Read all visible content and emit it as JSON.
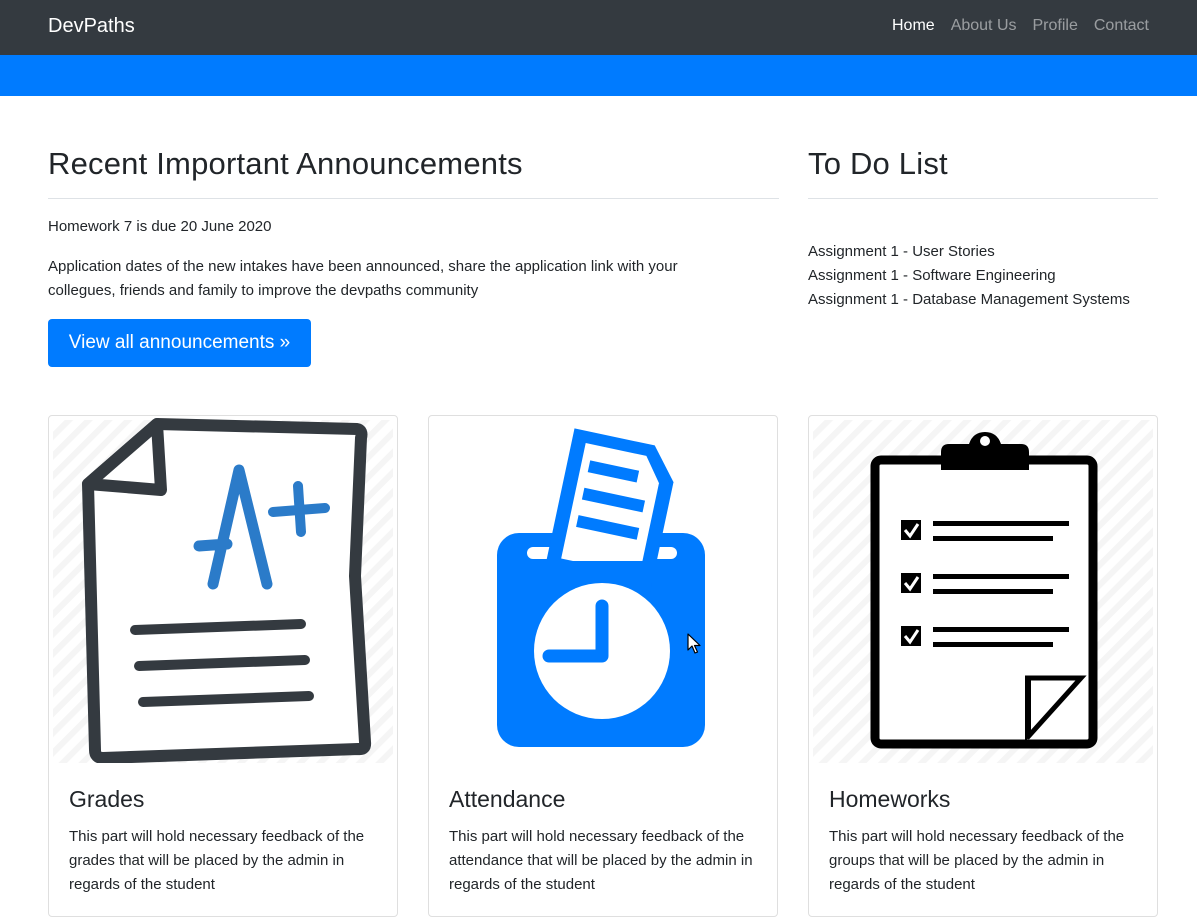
{
  "navbar": {
    "brand": "DevPaths",
    "links": [
      {
        "label": "Home",
        "active": true
      },
      {
        "label": "About Us",
        "active": false
      },
      {
        "label": "Profile",
        "active": false
      },
      {
        "label": "Contact",
        "active": false
      }
    ]
  },
  "colors": {
    "navbar": "#343a40",
    "accent": "#007bff",
    "icon_dark": "#343a40",
    "icon_blue": "#2b7bc9"
  },
  "announcements": {
    "title": "Recent Important Announcements",
    "items": [
      "Homework 7 is due 20 June 2020",
      "Application dates of the new intakes have been announced, share the application link with your collegues, friends and family to improve the devpaths community"
    ],
    "button": "View all announcements »"
  },
  "todo": {
    "title": "To Do List",
    "items": [
      "Assignment 1 - User Stories",
      "Assignment 1 - Software Engineering",
      "Assignment 1 - Database Management Systems"
    ]
  },
  "cards": [
    {
      "icon": "graded-paper-icon",
      "title": "Grades",
      "text": "This part will hold necessary feedback of the grades that will be placed by the admin in regards of the student"
    },
    {
      "icon": "attendance-clock-icon",
      "title": "Attendance",
      "text": "This part will hold necessary feedback of the attendance that will be placed by the admin in regards of the student"
    },
    {
      "icon": "clipboard-checklist-icon",
      "title": "Homeworks",
      "text": "This part will hold necessary feedback of the groups that will be placed by the admin in regards of the student"
    }
  ]
}
